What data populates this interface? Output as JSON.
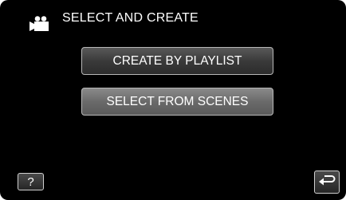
{
  "header": {
    "icon": "video-camera-icon",
    "title": "SELECT AND CREATE"
  },
  "menu": {
    "items": [
      {
        "label": "CREATE BY PLAYLIST"
      },
      {
        "label": "SELECT FROM SCENES"
      }
    ]
  },
  "footer": {
    "help_label": "?",
    "help_icon": "help-icon",
    "back_icon": "return-arrow-icon"
  },
  "colors": {
    "background": "#000000",
    "text": "#ffffff",
    "button_border": "#b8b8b8"
  }
}
